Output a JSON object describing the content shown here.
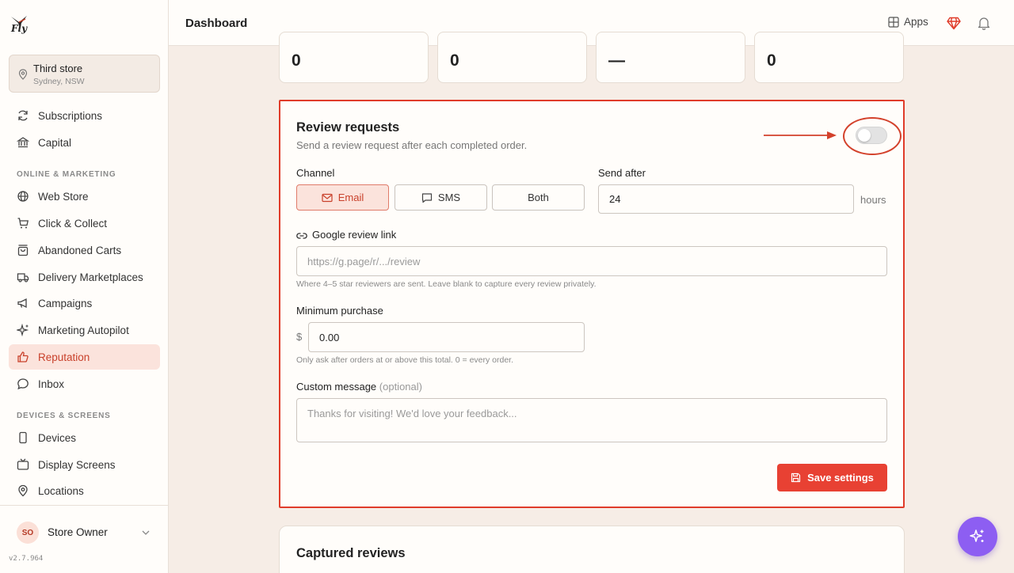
{
  "app": {
    "logo_text": "Fly",
    "version": "v2.7.964"
  },
  "store": {
    "name": "Third store",
    "location": "Sydney, NSW"
  },
  "sidebar": {
    "top_items": [
      {
        "label": "Subscriptions",
        "icon": "refresh-icon"
      },
      {
        "label": "Capital",
        "icon": "bank-icon"
      }
    ],
    "sections": [
      {
        "title": "ONLINE & MARKETING",
        "items": [
          {
            "label": "Web Store",
            "icon": "globe-icon"
          },
          {
            "label": "Click & Collect",
            "icon": "cart-icon"
          },
          {
            "label": "Abandoned Carts",
            "icon": "bag-icon"
          },
          {
            "label": "Delivery Marketplaces",
            "icon": "truck-icon"
          },
          {
            "label": "Campaigns",
            "icon": "megaphone-icon"
          },
          {
            "label": "Marketing Autopilot",
            "icon": "sparkle-icon"
          },
          {
            "label": "Reputation",
            "icon": "thumbs-up-icon",
            "active": true
          },
          {
            "label": "Inbox",
            "icon": "chat-icon"
          }
        ]
      },
      {
        "title": "DEVICES & SCREENS",
        "items": [
          {
            "label": "Devices",
            "icon": "phone-icon"
          },
          {
            "label": "Display Screens",
            "icon": "tv-icon"
          },
          {
            "label": "Locations",
            "icon": "pin-icon"
          }
        ]
      }
    ]
  },
  "user": {
    "initials": "SO",
    "name": "Store Owner"
  },
  "header": {
    "title": "Dashboard",
    "apps_label": "Apps"
  },
  "stats": [
    "0",
    "0",
    "—",
    "0"
  ],
  "review": {
    "title": "Review requests",
    "subtitle": "Send a review request after each completed order.",
    "enabled": false,
    "channel_label": "Channel",
    "channels": [
      {
        "label": "Email",
        "selected": true
      },
      {
        "label": "SMS",
        "selected": false
      },
      {
        "label": "Both",
        "selected": false
      }
    ],
    "send_after_label": "Send after",
    "send_after_value": "24",
    "send_after_unit": "hours",
    "google_label": "Google review link",
    "google_placeholder": "https://g.page/r/.../review",
    "google_hint": "Where 4–5 star reviewers are sent. Leave blank to capture every review privately.",
    "min_label": "Minimum purchase",
    "currency": "$",
    "min_value": "0.00",
    "min_hint": "Only ask after orders at or above this total. 0 = every order.",
    "msg_label": "Custom message",
    "msg_optional": "(optional)",
    "msg_placeholder": "Thanks for visiting! We'd love your feedback...",
    "save_label": "Save settings"
  },
  "captured": {
    "title": "Captured reviews"
  },
  "colors": {
    "accent": "#e84133",
    "active_bg": "#fbe3dc",
    "fab": "#8d5ef2"
  }
}
